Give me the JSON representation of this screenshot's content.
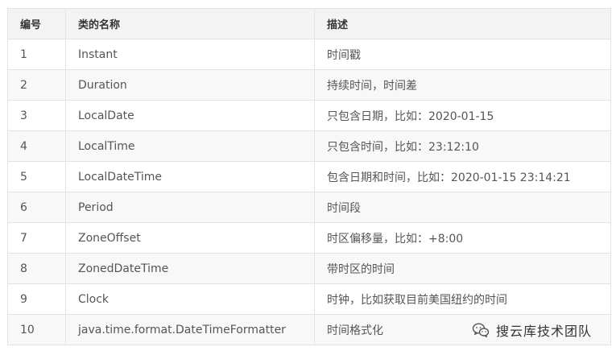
{
  "table": {
    "headers": [
      "编号",
      "类的名称",
      "描述"
    ],
    "rows": [
      [
        "1",
        "Instant",
        "时间戳"
      ],
      [
        "2",
        "Duration",
        "持续时间，时间差"
      ],
      [
        "3",
        "LocalDate",
        "只包含日期，比如：2020-01-15"
      ],
      [
        "4",
        "LocalTime",
        "只包含时间，比如：23:12:10"
      ],
      [
        "5",
        "LocalDateTime",
        "包含日期和时间，比如：2020-01-15 23:14:21"
      ],
      [
        "6",
        "Period",
        "时间段"
      ],
      [
        "7",
        "ZoneOffset",
        "时区偏移量，比如：+8:00"
      ],
      [
        "8",
        "ZonedDateTime",
        "带时区的时间"
      ],
      [
        "9",
        "Clock",
        "时钟，比如获取目前美国纽约的时间"
      ],
      [
        "10",
        "java.time.format.DateTimeFormatter",
        "时间格式化"
      ]
    ]
  },
  "watermark": {
    "icon": "wechat-icon",
    "text": "搜云库技术团队"
  }
}
